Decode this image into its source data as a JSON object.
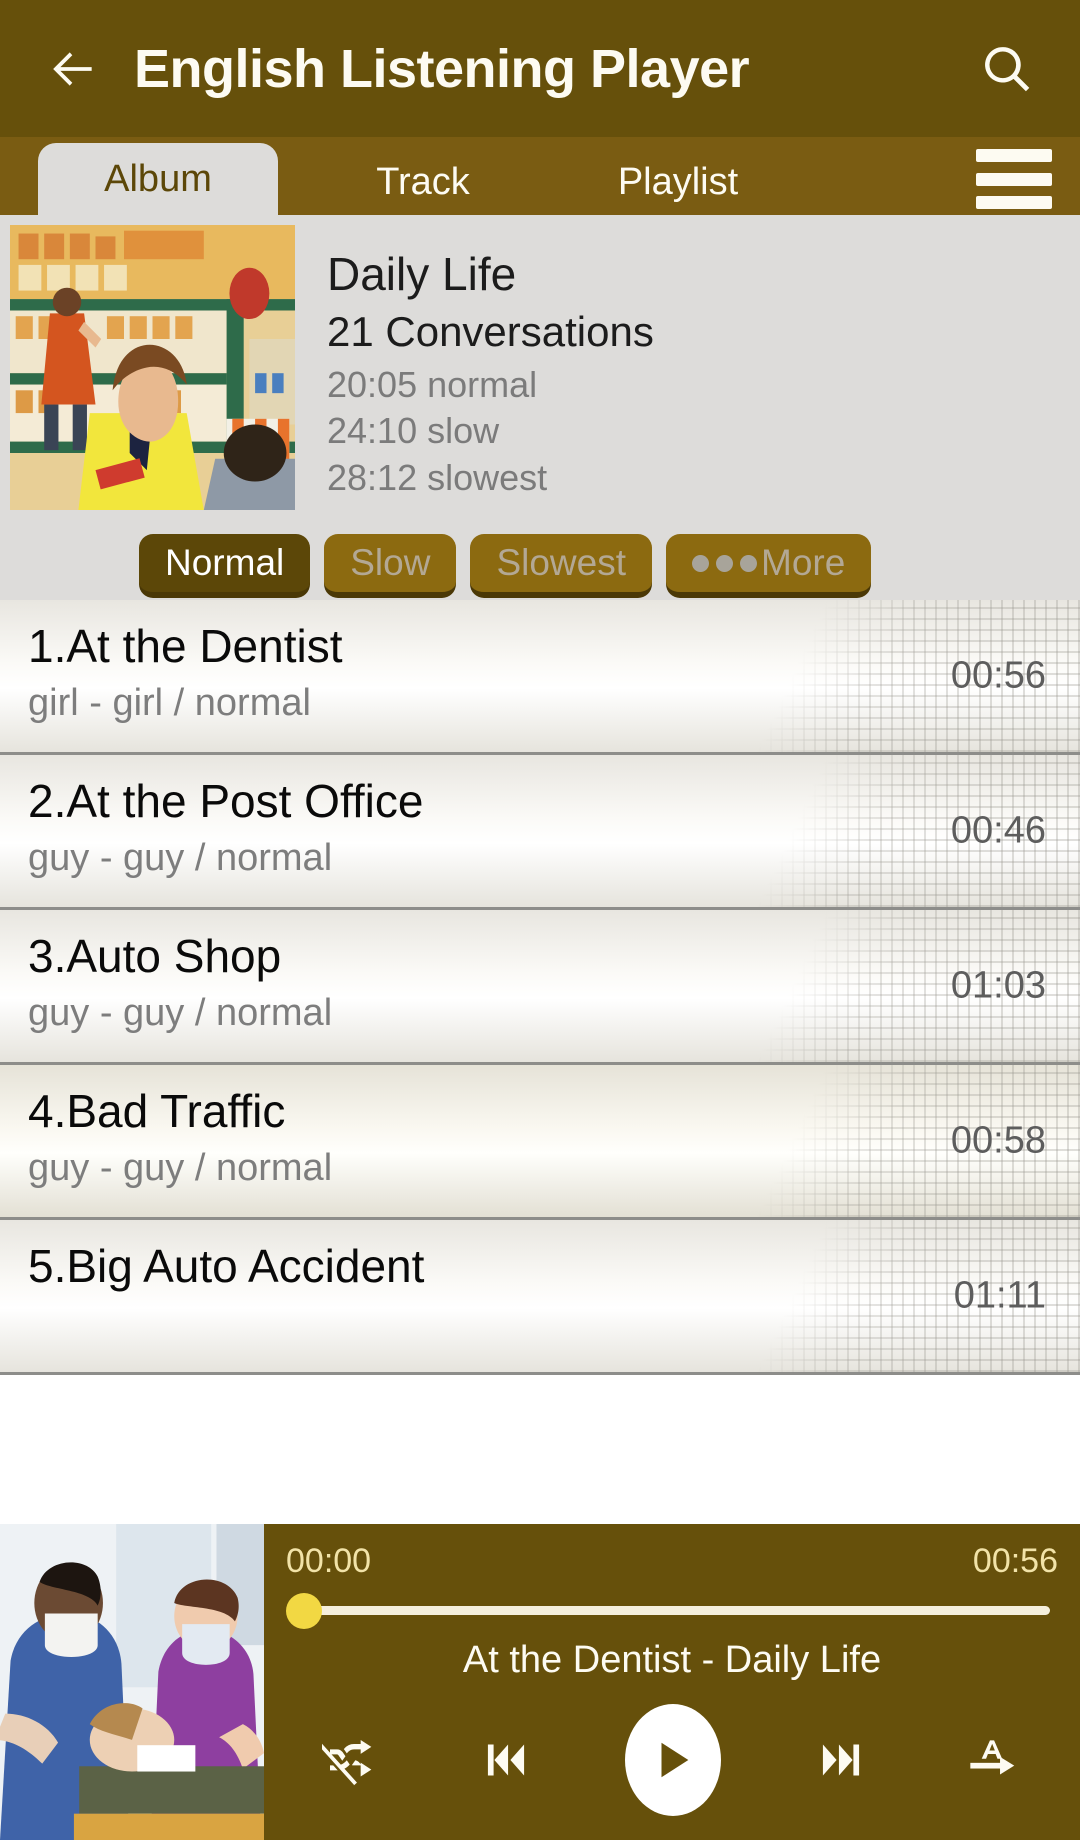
{
  "header": {
    "title": "English Listening Player",
    "back_icon": "arrow-left-icon",
    "search_icon": "search-icon"
  },
  "tabs": {
    "items": [
      {
        "label": "Album",
        "active": true
      },
      {
        "label": "Track",
        "active": false
      },
      {
        "label": "Playlist",
        "active": false
      }
    ],
    "menu_icon": "hamburger-menu-icon"
  },
  "album": {
    "title": "Daily Life",
    "subtitle": "21 Conversations",
    "durations": [
      "20:05 normal",
      "24:10 slow",
      "28:12 slowest"
    ],
    "art_alt": "vintage-grocery-store-illustration"
  },
  "speed_buttons": [
    {
      "label": "Normal",
      "selected": true
    },
    {
      "label": "Slow",
      "selected": false
    },
    {
      "label": "Slowest",
      "selected": false
    },
    {
      "label": "More",
      "selected": false,
      "dots": true
    }
  ],
  "tracks": [
    {
      "title": "1.At the Dentist",
      "subtitle": "girl - girl / normal",
      "time": "00:56"
    },
    {
      "title": "2.At the Post Office",
      "subtitle": "guy - guy / normal",
      "time": "00:46"
    },
    {
      "title": "3.Auto Shop",
      "subtitle": "guy - guy / normal",
      "time": "01:03"
    },
    {
      "title": "4.Bad Traffic",
      "subtitle": "guy - guy / normal",
      "time": "00:58"
    },
    {
      "title": "5.Big Auto Accident",
      "subtitle": "",
      "time": "01:11"
    }
  ],
  "player": {
    "elapsed": "00:00",
    "duration": "00:56",
    "now_playing": "At the Dentist - Daily Life",
    "progress_percent": 0,
    "thumb_alt": "dental-clinic-photo",
    "controls": [
      {
        "name": "shuffle-off-icon"
      },
      {
        "name": "previous-track-icon"
      },
      {
        "name": "play-icon"
      },
      {
        "name": "next-track-icon"
      },
      {
        "name": "repeat-a-arrow-icon"
      }
    ]
  },
  "colors": {
    "header_brown": "#66500b",
    "tabbar_brown": "#7a5c12",
    "panel_gray": "#dddcda",
    "accent_yellow": "#f2d843",
    "time_text": "#f2e3a8"
  }
}
